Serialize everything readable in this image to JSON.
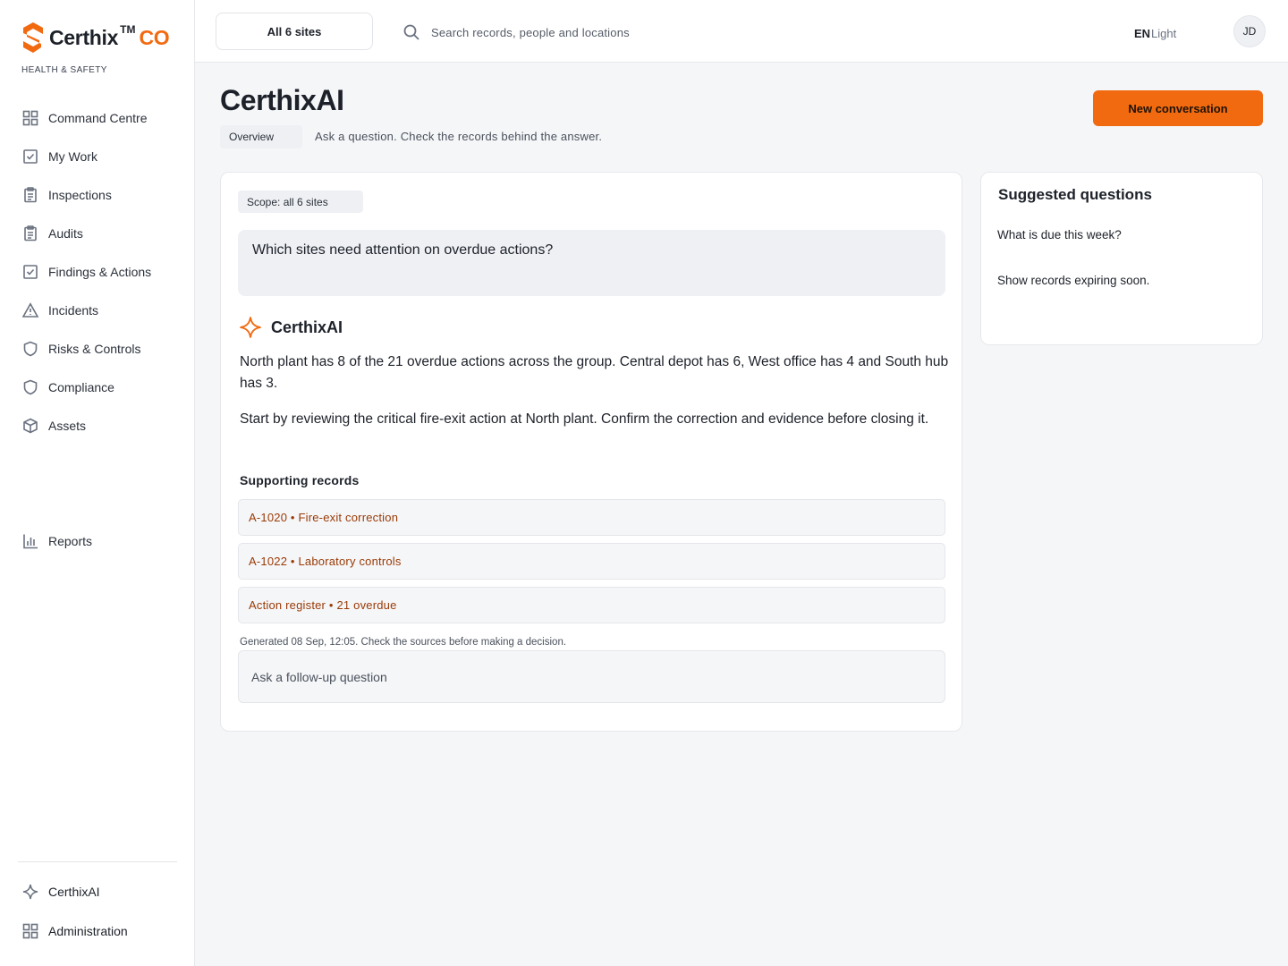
{
  "brand": {
    "name": "Certhix",
    "tm": "TM",
    "suffix": "CO",
    "subtitle": "HEALTH & SAFETY",
    "accent": "#f26a10"
  },
  "sidebar": {
    "items": [
      {
        "label": "Command Centre",
        "icon": "grid-icon"
      },
      {
        "label": "My Work",
        "icon": "checkbox-icon"
      },
      {
        "label": "Inspections",
        "icon": "clipboard-icon"
      },
      {
        "label": "Audits",
        "icon": "clipboard-icon"
      },
      {
        "label": "Findings & Actions",
        "icon": "checkbox-icon"
      },
      {
        "label": "Incidents",
        "icon": "warning-icon"
      },
      {
        "label": "Risks & Controls",
        "icon": "shield-icon"
      },
      {
        "label": "Compliance",
        "icon": "shield-icon"
      },
      {
        "label": "Assets",
        "icon": "cube-icon"
      }
    ],
    "reports": {
      "label": "Reports",
      "icon": "bar-chart-icon"
    },
    "bottom": [
      {
        "label": "CerthixAI",
        "icon": "sparkle-icon"
      },
      {
        "label": "Administration",
        "icon": "grid-icon"
      }
    ]
  },
  "topbar": {
    "site_selector": "All 6 sites",
    "search_placeholder": "Search records, people and locations",
    "language": "EN",
    "theme": "Light",
    "avatar_initials": "JD"
  },
  "header": {
    "title": "CerthixAI",
    "tab": "Overview",
    "subtitle": "Ask a question. Check the records behind the answer.",
    "new_button": "New conversation"
  },
  "chat": {
    "scope": "Scope: all 6 sites",
    "question": "Which sites need attention on overdue actions?",
    "assistant_name": "CerthixAI",
    "answer_paragraphs": [
      "North plant has 8 of the 21 overdue actions across the group. Central depot has 6, West office has 4 and South hub has 3.",
      "Start by reviewing the critical fire-exit action at North plant. Confirm the correction and evidence before closing it."
    ],
    "supporting_title": "Supporting records",
    "records": [
      "A-1020 • Fire-exit correction",
      "A-1022 • Laboratory controls",
      "Action register • 21 overdue"
    ],
    "generated": "Generated 08 Sep, 12:05. Check the sources before making a decision.",
    "followup_placeholder": "Ask a follow-up question"
  },
  "suggested": {
    "title": "Suggested questions",
    "items": [
      "What is due this week?",
      "Show records expiring soon."
    ]
  }
}
